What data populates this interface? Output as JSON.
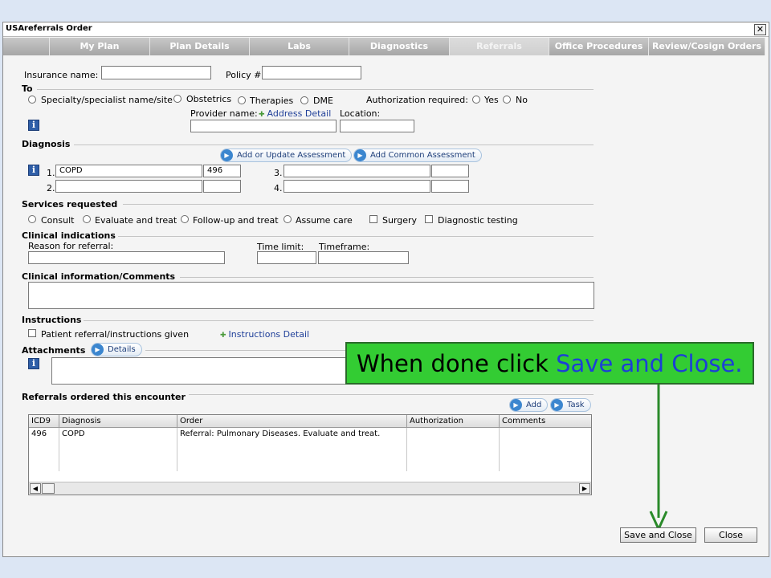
{
  "window": {
    "title": "USAreferrals Order",
    "close_glyph": "✕"
  },
  "tabs": [
    {
      "label": "My Plan"
    },
    {
      "label": "Plan Details"
    },
    {
      "label": "Labs"
    },
    {
      "label": "Diagnostics"
    },
    {
      "label": "Referrals",
      "active": true
    },
    {
      "label": "Office Procedures"
    },
    {
      "label": "Review/Cosign Orders"
    }
  ],
  "insurance": {
    "name_label": "Insurance name:",
    "name_value": "",
    "policy_label": "Policy #",
    "policy_value": ""
  },
  "to": {
    "heading": "To",
    "options": [
      "Specialty/specialist name/site",
      "Obstetrics",
      "Therapies",
      "DME"
    ],
    "auth_label": "Authorization required:",
    "auth_options": [
      "Yes",
      "No"
    ],
    "provider_label": "Provider name:",
    "address_link": "Address Detail",
    "location_label": "Location:"
  },
  "diagnosis": {
    "heading": "Diagnosis",
    "add_update_btn": "Add or Update Assessment",
    "add_common_btn": "Add Common Assessment",
    "rows": [
      {
        "num": "1.",
        "desc": "COPD",
        "code": "496"
      },
      {
        "num": "2.",
        "desc": "",
        "code": ""
      },
      {
        "num": "3.",
        "desc": "",
        "code": ""
      },
      {
        "num": "4.",
        "desc": "",
        "code": ""
      }
    ]
  },
  "services": {
    "heading": "Services requested",
    "options": [
      "Consult",
      "Evaluate and treat",
      "Follow-up and treat",
      "Assume care"
    ],
    "checks": [
      "Surgery",
      "Diagnostic testing"
    ]
  },
  "clinical": {
    "heading": "Clinical indications",
    "reason_label": "Reason for referral:",
    "time_limit_label": "Time limit:",
    "timeframe_label": "Timeframe:"
  },
  "comments": {
    "heading": "Clinical information/Comments"
  },
  "instructions": {
    "heading": "Instructions",
    "check_label": "Patient referral/instructions given",
    "detail_link": "Instructions Detail"
  },
  "attachments": {
    "heading": "Attachments",
    "details_btn": "Details"
  },
  "callout": {
    "prefix": "When done click ",
    "highlight": "Save and Close",
    "suffix": ".",
    "color": "#33cc33"
  },
  "referrals": {
    "heading": "Referrals ordered this encounter",
    "add_btn": "Add",
    "task_btn": "Task",
    "columns": [
      "ICD9",
      "Diagnosis",
      "Order",
      "Authorization",
      "Comments"
    ],
    "rows": [
      {
        "icd9": "496",
        "diagnosis": "COPD",
        "order": "Referral: Pulmonary Diseases. Evaluate and treat.",
        "authorization": "",
        "comments": ""
      }
    ]
  },
  "footer": {
    "save_close": "Save and Close",
    "close": "Close"
  },
  "icons": {
    "info": "info-icon",
    "scroll_left": "◀",
    "scroll_right": "▶"
  }
}
